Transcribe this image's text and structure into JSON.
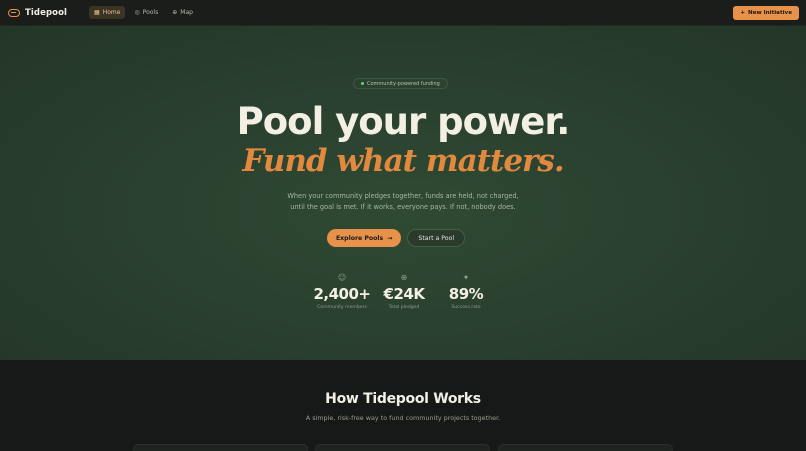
{
  "header": {
    "brand": "Tidepool",
    "nav": [
      {
        "label": "Home",
        "icon": "grid-icon",
        "active": true
      },
      {
        "label": "Pools",
        "icon": "pools-icon",
        "active": false
      },
      {
        "label": "Map",
        "icon": "globe-icon",
        "active": false
      }
    ],
    "new_button": "New Initiative"
  },
  "hero": {
    "badge": "Community-powered funding",
    "headline": "Pool your power.",
    "tagline": "Fund what matters.",
    "subtitle_line1": "When your community pledges together, funds are held, not charged,",
    "subtitle_line2": "until the goal is met. If it works, everyone pays. If not, nobody does.",
    "primary_cta": "Explore Pools",
    "secondary_cta": "Start a Pool",
    "stats": [
      {
        "value": "2,400+",
        "label": "Community members",
        "icon": "users-icon"
      },
      {
        "value": "€24K",
        "label": "Total pledged",
        "icon": "globe-icon"
      },
      {
        "value": "89%",
        "label": "Success rate",
        "icon": "sparkle-icon"
      }
    ]
  },
  "how": {
    "title": "How Tidepool Works",
    "subtitle": "A simple, risk-free way to fund community projects together."
  },
  "colors": {
    "accent": "#e8914a",
    "hero_bg": "#2a4030",
    "dark_bg": "#161917"
  }
}
